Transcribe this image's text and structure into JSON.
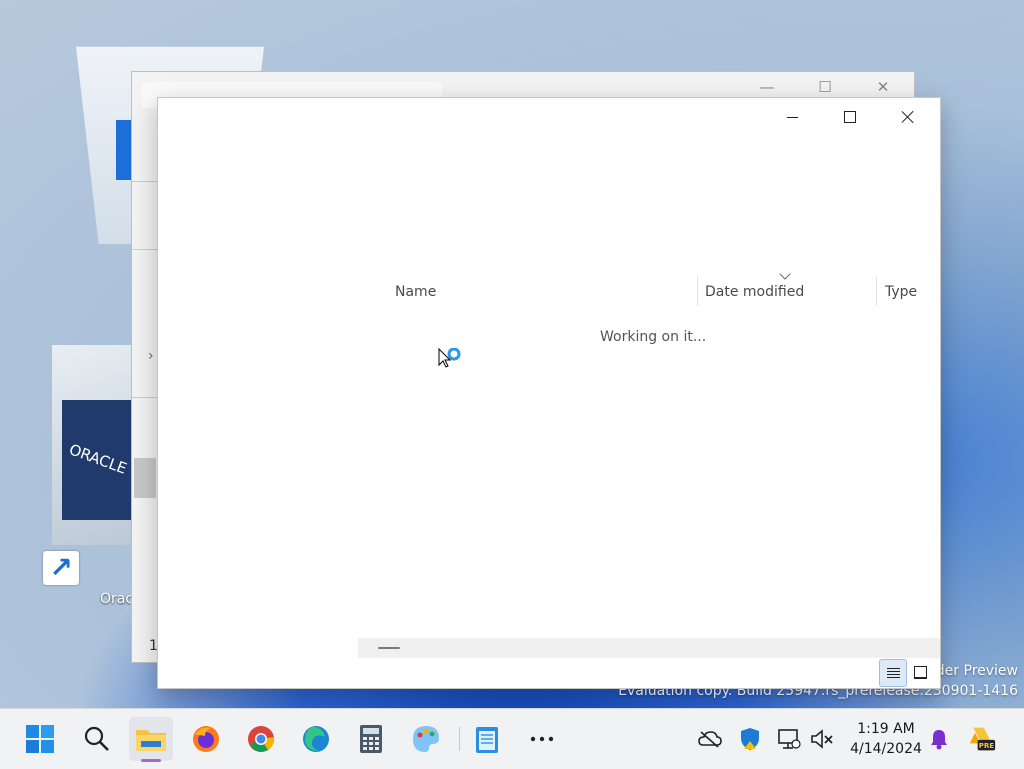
{
  "desktop": {
    "shortcut_label": "Orac",
    "vbox_logo_text": "ORACLE",
    "watermark_line1": "der Preview",
    "watermark_line2": "Evaluation copy. Build 25947.rs_prerelease.230901-1416"
  },
  "background_window": {
    "tab_title": "",
    "status_count": "1"
  },
  "explorer": {
    "columns": {
      "name": "Name",
      "date_modified": "Date modified",
      "type": "Type"
    },
    "sort_column": "Date modified",
    "status": "Working on it...",
    "view_mode": "details"
  },
  "taskbar": {
    "apps": [
      "start-icon",
      "search-icon",
      "file-explorer-icon",
      "firefox-icon",
      "chrome-icon",
      "edge-icon",
      "calculator-icon",
      "paint-icon",
      "notepad-icon",
      "more-icon"
    ],
    "active_app": "file-explorer-icon",
    "tray": [
      "onedrive-offline-icon",
      "windows-security-icon",
      "network-icon",
      "volume-muted-icon"
    ],
    "clock": {
      "time": "1:19 AM",
      "date": "4/14/2024"
    },
    "pre_badge": "PRE"
  },
  "colors": {
    "accent": "#0067c0",
    "taskbar_bg": "#f0f2f4",
    "active_indicator": "#a06ad0"
  }
}
